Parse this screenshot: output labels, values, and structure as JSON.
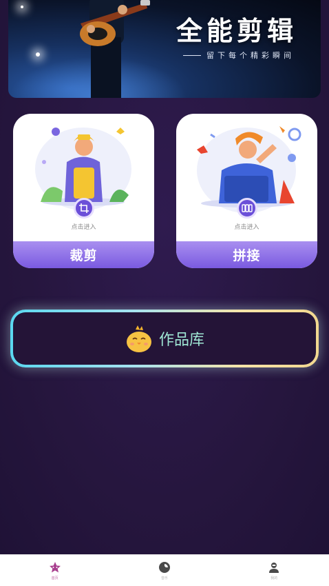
{
  "banner": {
    "title": "全能剪辑",
    "subtitle": "留下每个精彩瞬间"
  },
  "cards": [
    {
      "tap_hint": "点击进入",
      "label": "裁剪",
      "icon": "crop-icon"
    },
    {
      "tap_hint": "点击进入",
      "label": "拼接",
      "icon": "film-strip-icon"
    }
  ],
  "works": {
    "label": "作品库",
    "icon": "chick-icon"
  },
  "tabbar": {
    "items": [
      {
        "label": "首页",
        "icon": "star-icon",
        "active": true
      },
      {
        "label": "音乐",
        "icon": "disc-icon",
        "active": false
      },
      {
        "label": "我的",
        "icon": "user-icon",
        "active": false
      }
    ]
  },
  "colors": {
    "background": "#2a1844",
    "card_bar": "#8b6ee6",
    "works_text": "#9fe6d4",
    "tab_active": "#c06aa6"
  }
}
